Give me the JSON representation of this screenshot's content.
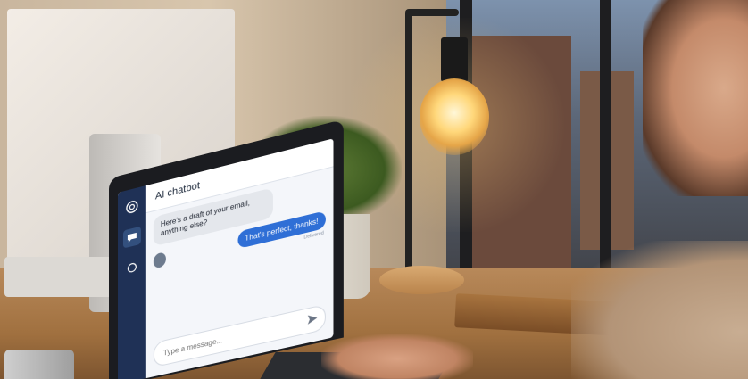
{
  "chat_app": {
    "title": "AI chatbot",
    "messages": [
      {
        "from": "bot",
        "text": "Here's a draft of your email, anything else?"
      },
      {
        "from": "user",
        "text": "That's perfect, thanks!",
        "receipt": "Delivered"
      }
    ],
    "composer": {
      "placeholder": "Type a message..."
    },
    "icons": {
      "logo": "openai-logo-icon",
      "chat": "chat-bubble-icon",
      "threads": "chat-threads-icon",
      "send": "send-icon"
    }
  }
}
